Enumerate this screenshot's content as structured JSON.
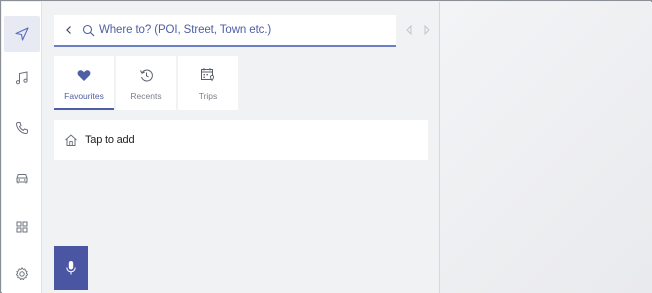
{
  "sidebar": {
    "items": [
      {
        "icon": "navigation-arrow-icon",
        "active": true
      },
      {
        "icon": "music-note-icon",
        "active": false
      },
      {
        "icon": "phone-icon",
        "active": false
      },
      {
        "icon": "car-icon",
        "active": false
      },
      {
        "icon": "apps-grid-icon",
        "active": false
      },
      {
        "icon": "settings-gear-icon",
        "active": false
      }
    ]
  },
  "search": {
    "placeholder": "Where to? (POI, Street, Town etc.)"
  },
  "tabs": [
    {
      "label": "Favourites",
      "icon": "heart-icon",
      "active": true
    },
    {
      "label": "Recents",
      "icon": "history-icon",
      "active": false
    },
    {
      "label": "Trips",
      "icon": "trips-icon",
      "active": false
    }
  ],
  "list": {
    "items": [
      {
        "label": "Tap to add",
        "icon": "home-icon"
      }
    ]
  },
  "voice": {
    "icon": "microphone-icon"
  },
  "colors": {
    "accent": "#4d5fa5",
    "mic_bg": "#4b56a3",
    "panel_bg": "#f1f2f4"
  }
}
